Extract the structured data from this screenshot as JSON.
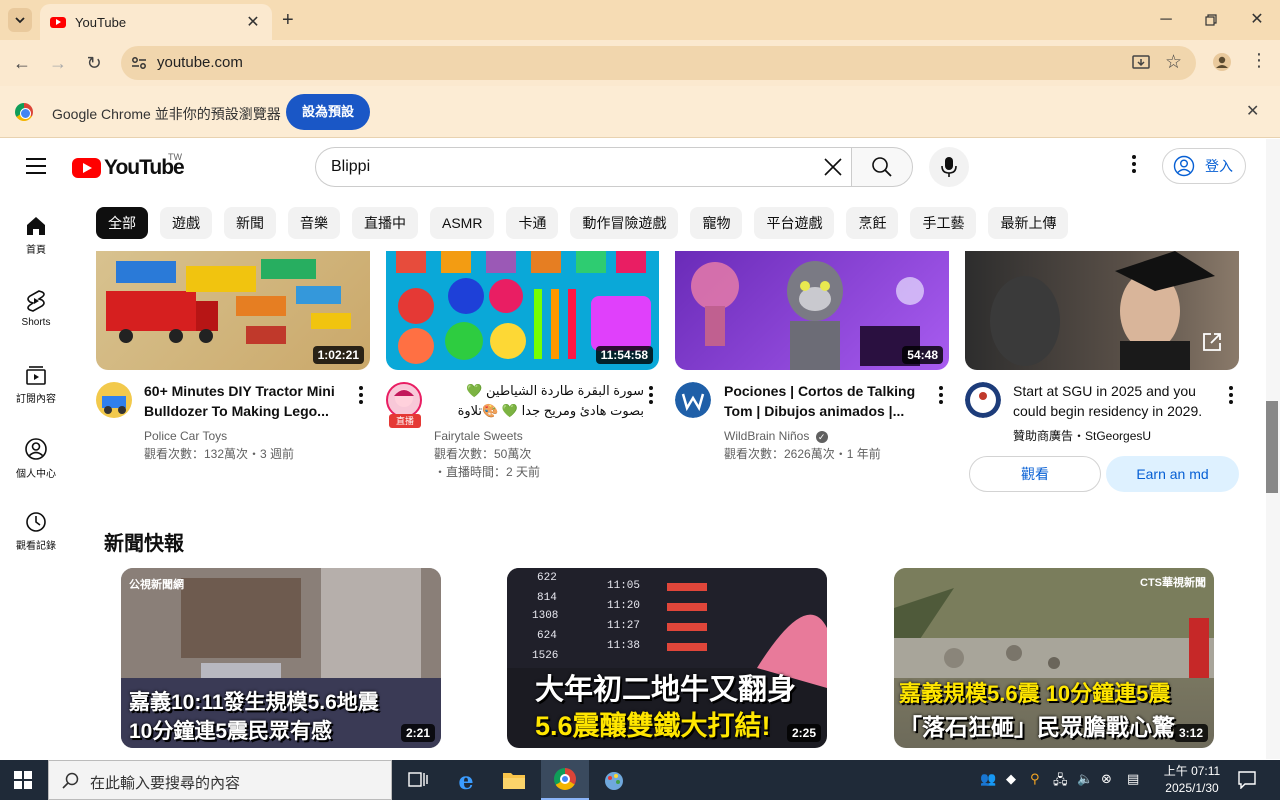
{
  "browser": {
    "tab_title": "YouTube",
    "new_tab": "+",
    "url": "youtube.com"
  },
  "infobar": {
    "message": "Google Chrome 並非你的預設瀏覽器",
    "button": "設為預設"
  },
  "masthead": {
    "logo": "YouTube",
    "region": "TW",
    "search_value": "Blippi",
    "sign_in": "登入"
  },
  "guide": [
    {
      "label": "首頁",
      "icon": "home-icon"
    },
    {
      "label": "Shorts",
      "icon": "shorts-icon"
    },
    {
      "label": "訂閱內容",
      "icon": "subscriptions-icon"
    },
    {
      "label": "個人中心",
      "icon": "you-icon"
    },
    {
      "label": "觀看記錄",
      "icon": "history-icon"
    }
  ],
  "chips": [
    "全部",
    "遊戲",
    "新聞",
    "音樂",
    "直播中",
    "ASMR",
    "卡通",
    "動作冒險遊戲",
    "寵物",
    "平台遊戲",
    "烹飪",
    "手工藝",
    "最新上傳"
  ],
  "videos": [
    {
      "title": "60+ Minutes DIY Tractor Mini Bulldozer To Making Lego...",
      "channel": "Police Car Toys",
      "meta": "觀看次數：132萬次・3 週前",
      "duration": "1:02:21"
    },
    {
      "title": "سورة البقرة طاردة الشياطين 💚 بصوت هادئ ومريح جدا 💚 🎨تلاوة هادئة",
      "channel": "Fairytale Sweets",
      "meta": "觀看次數：50萬次",
      "meta2": "・直播時間：2 天前",
      "duration": "11:54:58",
      "live_badge": "直播"
    },
    {
      "title": "Pociones | Cortos de Talking Tom | Dibujos animados |...",
      "channel": "WildBrain Niños",
      "meta": "觀看次數：2626萬次・1 年前",
      "duration": "54:48"
    },
    {
      "title": "Start at SGU in 2025 and you could begin residency in 2029.",
      "channel": "贊助商廣告・StGeorgesU",
      "watch": "觀看",
      "cta": "Earn an md"
    }
  ],
  "news": {
    "heading": "新聞快報",
    "items": [
      {
        "line1": "嘉義10:11發生規模5.6地震",
        "line2": "10分鐘連5震民眾有感",
        "duration": "2:21",
        "source": "公視新聞網"
      },
      {
        "line1": "大年初二地牛又翻身",
        "line2": "5.6震釀雙鐵大打結!",
        "duration": "2:25"
      },
      {
        "line1": "嘉義規模5.6震 10分鐘連5震",
        "line2": "「落石狂砸」民眾膽戰心驚",
        "duration": "3:12",
        "source": "CTS華視新聞"
      }
    ]
  },
  "taskbar": {
    "search_placeholder": "在此輸入要搜尋的內容",
    "time": "上午 07:11",
    "date": "2025/1/30"
  },
  "colors": {
    "chrome_frame": "#f6dcb4",
    "yt_red": "#ff0000",
    "link_blue": "#065fd4",
    "taskbar": "#1f2a38"
  }
}
